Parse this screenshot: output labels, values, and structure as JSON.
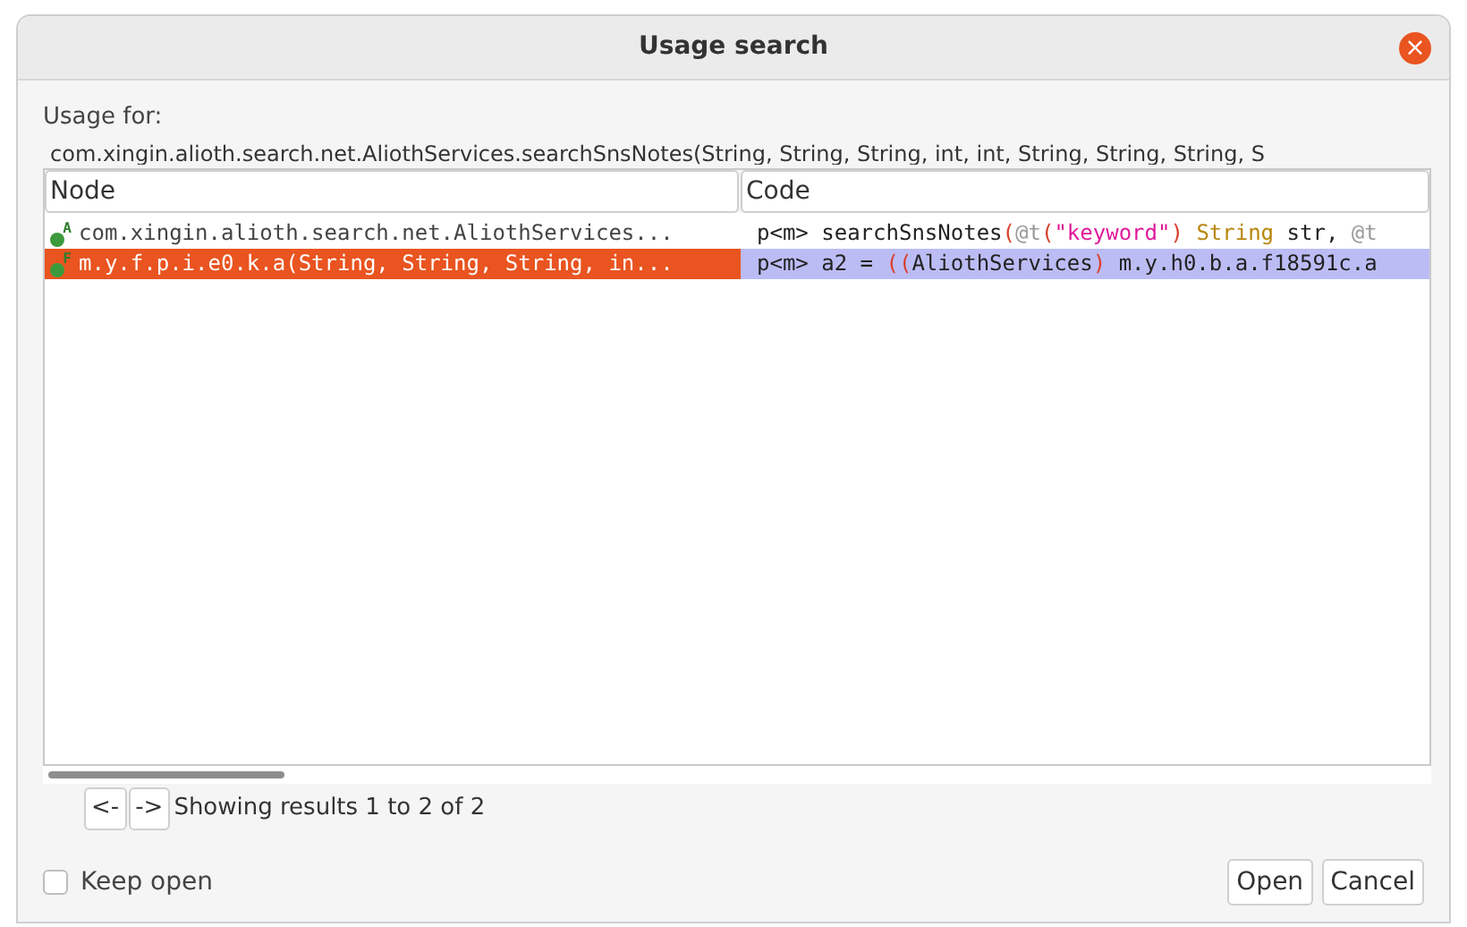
{
  "window": {
    "title": "Usage search",
    "close": "×"
  },
  "usage_for": {
    "label": "Usage for:",
    "target": "com.xingin.alioth.search.net.AliothServices.searchSnsNotes(String, String, String, int, int, String, String, String, S"
  },
  "table": {
    "columns": [
      "Node",
      "Code"
    ],
    "rows": [
      {
        "selected": false,
        "node": "com.xingin.alioth.search.net.AliothServices...",
        "node_icon": "A",
        "code": [
          {
            "kind": "plain",
            "text": "p<m> searchSnsNotes"
          },
          {
            "kind": "paren",
            "text": "("
          },
          {
            "kind": "annotation",
            "text": "@t"
          },
          {
            "kind": "paren",
            "text": "("
          },
          {
            "kind": "string",
            "text": "\"keyword\""
          },
          {
            "kind": "paren",
            "text": ") "
          },
          {
            "kind": "type",
            "text": "String"
          },
          {
            "kind": "plain",
            "text": " str, "
          },
          {
            "kind": "annotation",
            "text": "@t"
          }
        ]
      },
      {
        "selected": true,
        "node": "m.y.f.p.i.e0.k.a(String, String, String, in...",
        "node_icon": "F",
        "code": [
          {
            "kind": "plain",
            "text": "p<m> a2 = "
          },
          {
            "kind": "paren",
            "text": "(("
          },
          {
            "kind": "plain",
            "text": "AliothServices"
          },
          {
            "kind": "paren",
            "text": ")"
          },
          {
            "kind": "plain",
            "text": " m.y.h0.b.a.f18591c.a"
          }
        ]
      }
    ]
  },
  "pager": {
    "prev": "<-",
    "next": "->",
    "status": "Showing results 1 to 2 of 2"
  },
  "keep_open": {
    "label": "Keep open",
    "checked": false
  },
  "buttons": [
    "Open",
    "Cancel"
  ]
}
